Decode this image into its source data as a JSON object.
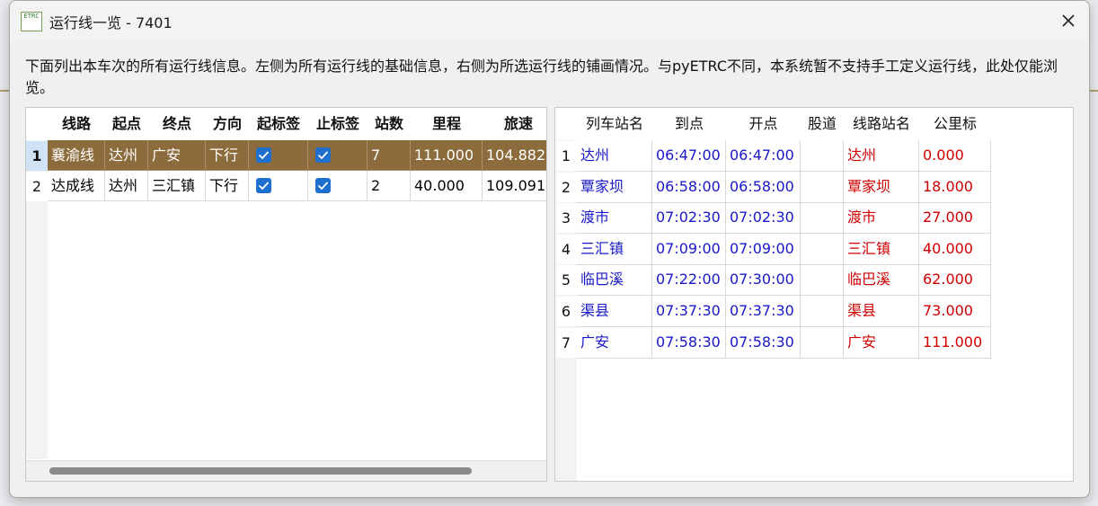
{
  "window": {
    "title": "运行线一览 - 7401",
    "icon_name": "etrc-app-icon",
    "icon_text": "ETRC",
    "close_icon": "close-icon"
  },
  "description": "下面列出本车次的所有运行线信息。左侧为所有运行线的基础信息，右侧为所选运行线的铺画情况。与pyETRC不同，本系统暂不支持手工定义运行线，此处仅能浏览。",
  "left_table": {
    "columns": [
      "线路",
      "起点",
      "终点",
      "方向",
      "起标签",
      "止标签",
      "站数",
      "里程",
      "旅速"
    ],
    "rows": [
      {
        "num": "1",
        "line": "襄渝线",
        "start": "达州",
        "end": "广安",
        "dir": "下行",
        "start_tag": true,
        "end_tag": true,
        "stations": "7",
        "mileage": "111.000",
        "speed": "104.882"
      },
      {
        "num": "2",
        "line": "达成线",
        "start": "达州",
        "end": "三汇镇",
        "dir": "下行",
        "start_tag": true,
        "end_tag": true,
        "stations": "2",
        "mileage": "40.000",
        "speed": "109.091"
      }
    ],
    "selected_row": 0
  },
  "right_table": {
    "columns": [
      "列车站名",
      "到点",
      "开点",
      "股道",
      "线路站名",
      "公里标"
    ],
    "rows": [
      {
        "num": "1",
        "train_station": "达州",
        "arrive": "06:47:00",
        "depart": "06:47:00",
        "track": "",
        "line_station": "达州",
        "km": "0.000"
      },
      {
        "num": "2",
        "train_station": "覃家坝",
        "arrive": "06:58:00",
        "depart": "06:58:00",
        "track": "",
        "line_station": "覃家坝",
        "km": "18.000"
      },
      {
        "num": "3",
        "train_station": "渡市",
        "arrive": "07:02:30",
        "depart": "07:02:30",
        "track": "",
        "line_station": "渡市",
        "km": "27.000"
      },
      {
        "num": "4",
        "train_station": "三汇镇",
        "arrive": "07:09:00",
        "depart": "07:09:00",
        "track": "",
        "line_station": "三汇镇",
        "km": "40.000"
      },
      {
        "num": "5",
        "train_station": "临巴溪",
        "arrive": "07:22:00",
        "depart": "07:30:00",
        "track": "",
        "line_station": "临巴溪",
        "km": "62.000"
      },
      {
        "num": "6",
        "train_station": "渠县",
        "arrive": "07:37:30",
        "depart": "07:37:30",
        "track": "",
        "line_station": "渠县",
        "km": "73.000"
      },
      {
        "num": "7",
        "train_station": "广安",
        "arrive": "07:58:30",
        "depart": "07:58:30",
        "track": "",
        "line_station": "广安",
        "km": "111.000"
      }
    ]
  },
  "colors": {
    "selected_row_bg": "#8c6c3c",
    "checkbox": "#1f6fcf",
    "train_station_text": "#1818c8",
    "line_station_text": "#d00000"
  }
}
